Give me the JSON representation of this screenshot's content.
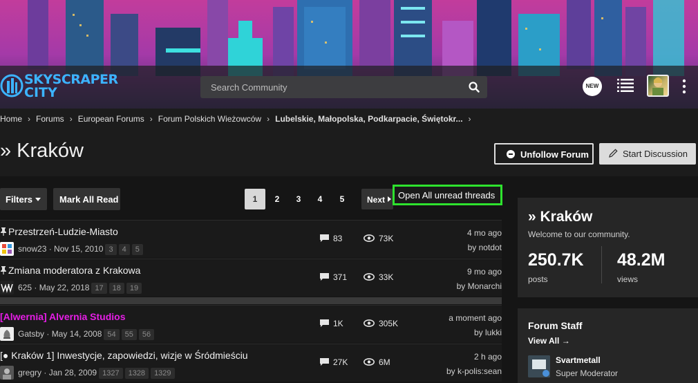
{
  "header": {
    "logo_line1": "SKYSCRAPER",
    "logo_line2": "CITY",
    "search_placeholder": "Search Community",
    "new_badge": "NEW"
  },
  "breadcrumb": [
    "Home",
    "Forums",
    "European Forums",
    "Forum Polskich Wieżowców",
    "Lubelskie, Małopolska, Podkarpacie, Świętokr..."
  ],
  "page": {
    "title": "» Kraków",
    "unfollow_label": "Unfollow Forum",
    "start_label": "Start Discussion"
  },
  "toolbar": {
    "filters_label": "Filters",
    "markread_label": "Mark All Read",
    "pages": [
      "1",
      "2",
      "3",
      "4",
      "5"
    ],
    "current_page": "1",
    "next_label": "Next",
    "unread_label": "Open All unread threads"
  },
  "threads": [
    {
      "title": "Przestrzeń-Ludzie-Miasto",
      "pinned": true,
      "author": "snow23",
      "date": "Nov 15, 2010",
      "pages": [
        "3",
        "4",
        "5"
      ],
      "replies": "83",
      "views": "73K",
      "last_time": "4 mo ago",
      "last_by": "by notdot"
    },
    {
      "title": "Zmiana moderatora z Krakowa",
      "pinned": true,
      "author": "625",
      "date": "May 22, 2018",
      "pages": [
        "17",
        "18",
        "19"
      ],
      "replies": "371",
      "views": "33K",
      "last_time": "9 mo ago",
      "last_by": "by Monarchi"
    },
    {
      "title": "[Alwernia] Alvernia Studios",
      "pinned": false,
      "author": "Gatsby",
      "date": "May 14, 2008",
      "pages": [
        "54",
        "55",
        "56"
      ],
      "replies": "1K",
      "views": "305K",
      "last_time": "a moment ago",
      "last_by": "by lukki"
    },
    {
      "title": "[● Kraków 1] Inwestycje, zapowiedzi, wizje w Śródmieściu",
      "pinned": false,
      "author": "gregry",
      "date": "Jan 28, 2009",
      "pages": [
        "1327",
        "1328",
        "1329"
      ],
      "replies": "27K",
      "views": "6M",
      "last_time": "2 h ago",
      "last_by": "by k-polis:sean"
    }
  ],
  "sidebar": {
    "title": "» Kraków",
    "welcome": "Welcome to our community.",
    "posts_value": "250.7K",
    "posts_label": "posts",
    "views_value": "48.2M",
    "views_label": "views",
    "staff_title": "Forum Staff",
    "staff_viewall": "View All",
    "staff_name": "Svartmetall",
    "staff_role": "Super Moderator"
  },
  "colors": {
    "unread_outline": "#2ee32e",
    "logo_blue": "#3cb4ff",
    "highlight_title": "#e61ee6"
  },
  "icons": [
    "search-icon",
    "list-icon",
    "kebab-icon",
    "pin-icon",
    "message-icon",
    "eye-icon",
    "pencil-icon",
    "minus-circle-icon",
    "arrow-right-icon"
  ]
}
